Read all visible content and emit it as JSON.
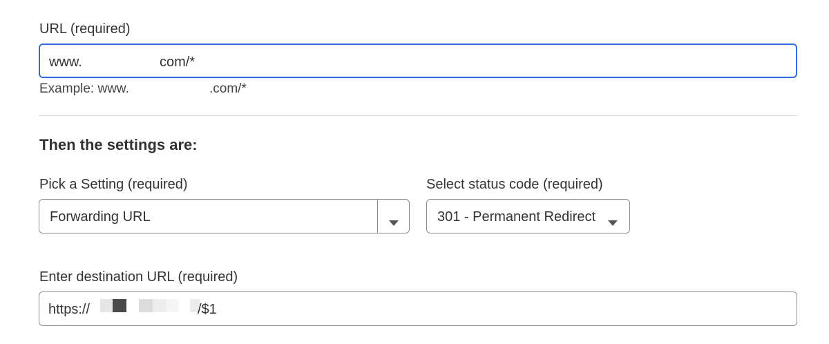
{
  "url_field": {
    "label": "URL (required)",
    "value_prefix": "www.",
    "value_suffix": "com/*",
    "help_prefix": "Example: www.",
    "help_suffix": ".com/*"
  },
  "settings": {
    "heading": "Then the settings are:"
  },
  "pick_setting": {
    "label": "Pick a Setting (required)",
    "value": "Forwarding URL",
    "icon": "chevron-down-icon"
  },
  "status_code": {
    "label": "Select status code (required)",
    "value": "301 - Permanent Redirect",
    "icon": "chevron-down-icon"
  },
  "destination": {
    "label": "Enter destination URL (required)",
    "value_prefix": "https://",
    "value_suffix": "/$1"
  },
  "colors": {
    "focus_border": "#2f6ee0",
    "border": "#8a8a8a",
    "text": "#333333"
  }
}
